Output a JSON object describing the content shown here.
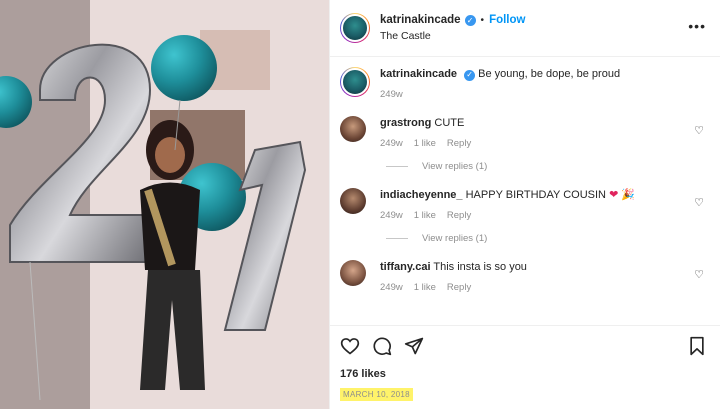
{
  "header": {
    "username": "katrinakincade",
    "verified_icon": "verified-badge-icon",
    "dot": "•",
    "follow_label": "Follow",
    "location": "The Castle",
    "more_icon": "more-options-icon",
    "more_label": "•••"
  },
  "caption": {
    "username": "katrinakincade",
    "text": "Be young, be dope, be proud",
    "time": "249w"
  },
  "comments": [
    {
      "username": "grastrong",
      "text": "CUTE",
      "time": "249w",
      "likes": "1 like",
      "reply": "Reply",
      "view_replies": "View replies (1)"
    },
    {
      "username": "indiacheyenne_",
      "text": "HAPPY BIRTHDAY COUSIN",
      "emojis": "❤ 🎉",
      "time": "249w",
      "likes": "1 like",
      "reply": "Reply",
      "view_replies": "View replies (1)"
    },
    {
      "username": "tiffany.cai",
      "text": "This insta is so you",
      "time": "249w",
      "likes": "1 like",
      "reply": "Reply"
    }
  ],
  "actions": {
    "like_icon": "heart-icon",
    "comment_icon": "comment-icon",
    "share_icon": "share-icon",
    "save_icon": "bookmark-icon",
    "likes_count": "176 likes",
    "date": "MARCH 10, 2018"
  },
  "photo": {
    "balloon_number": "21"
  },
  "colors": {
    "follow": "#0095f6",
    "date_highlight": "#fff36a",
    "balloon_teal": "#1e8e9a"
  }
}
